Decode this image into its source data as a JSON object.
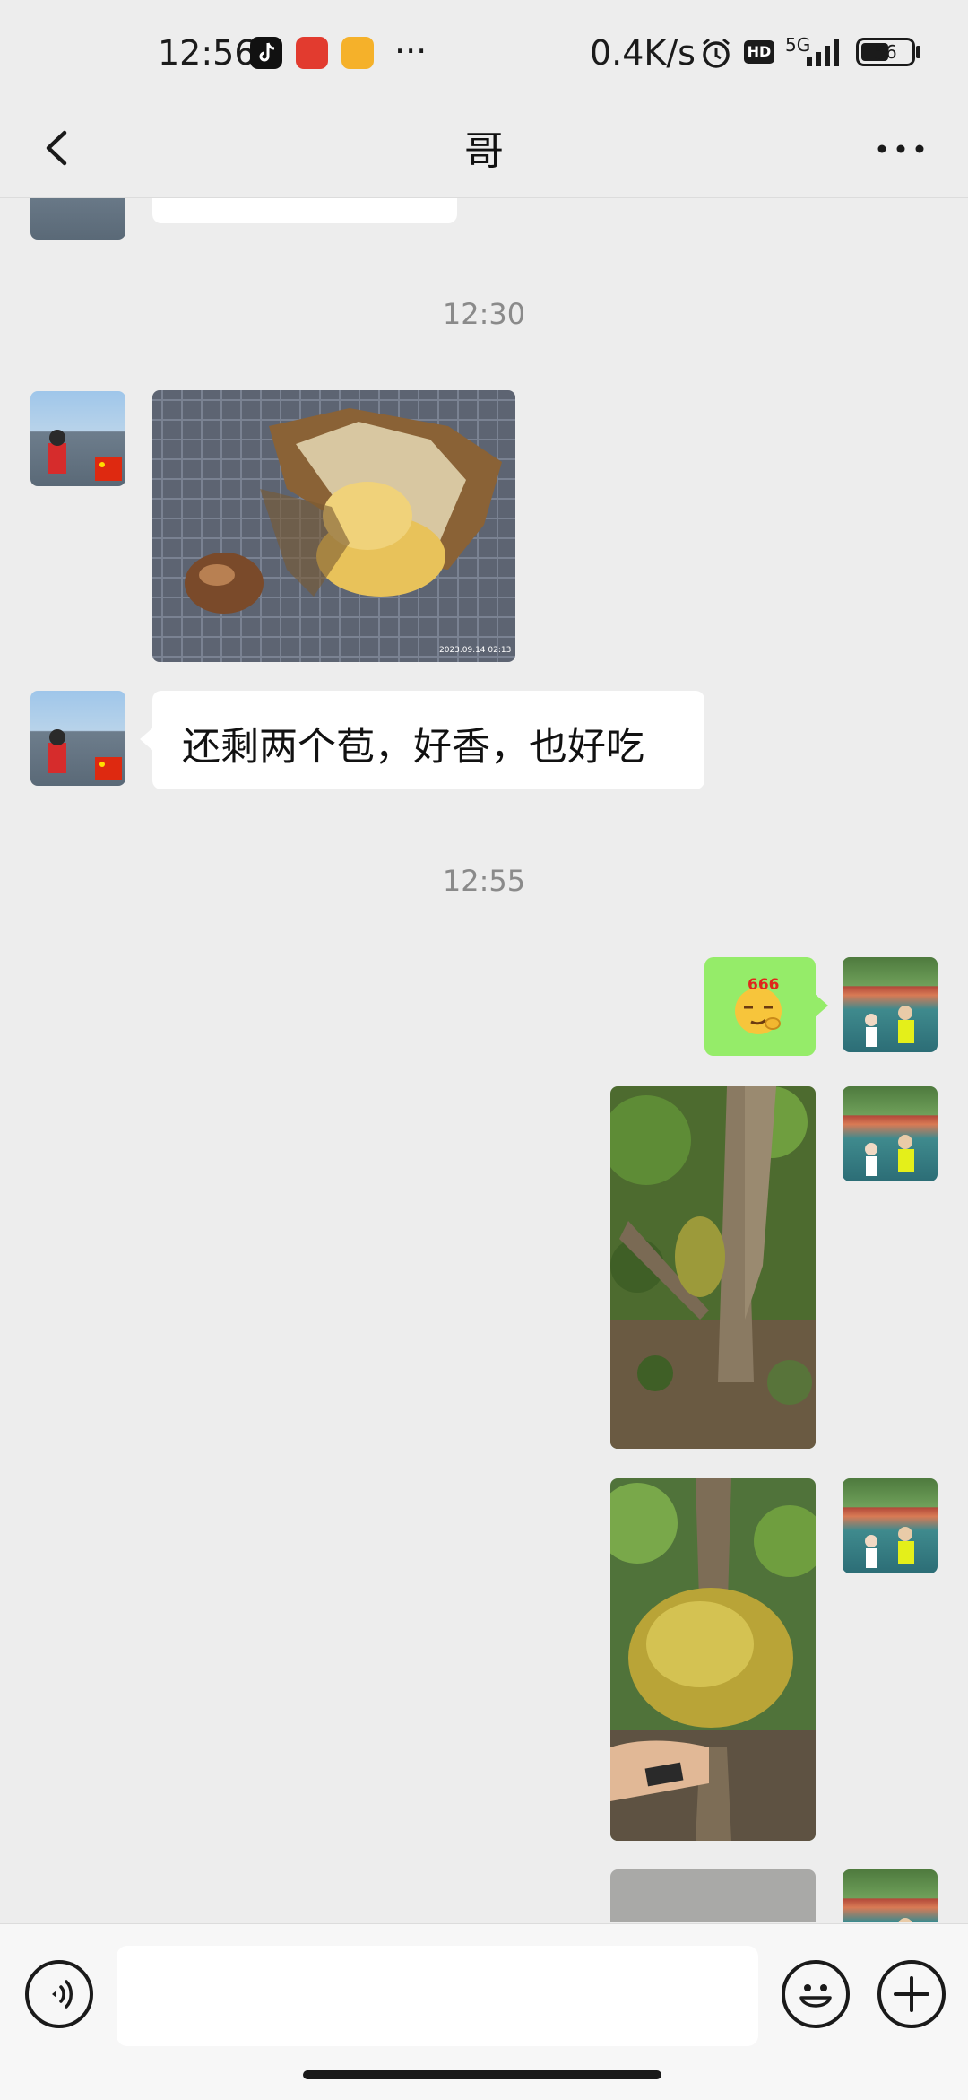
{
  "status_bar": {
    "time": "12:56",
    "more": "···",
    "net_speed": "0.4K/s",
    "hd_label": "HD",
    "network": "5G",
    "battery": "56"
  },
  "header": {
    "title": "哥"
  },
  "messages": {
    "timestamp_1": "12:30",
    "text_1": "还剩两个苞，好香，也好吃",
    "timestamp_2": "12:55",
    "sticker_text": "666"
  },
  "photo_stamps": {
    "photo_1": "2023.09.14  02:13"
  },
  "colors": {
    "background": "#ededed",
    "bubble_incoming": "#ffffff",
    "bubble_outgoing": "#95ec69",
    "timestamp": "#8a8a8a"
  },
  "icons": {
    "back": "chevron-left-icon",
    "menu": "more-dots-icon",
    "voice": "voice-icon",
    "emoji": "emoji-icon",
    "add": "plus-icon"
  }
}
